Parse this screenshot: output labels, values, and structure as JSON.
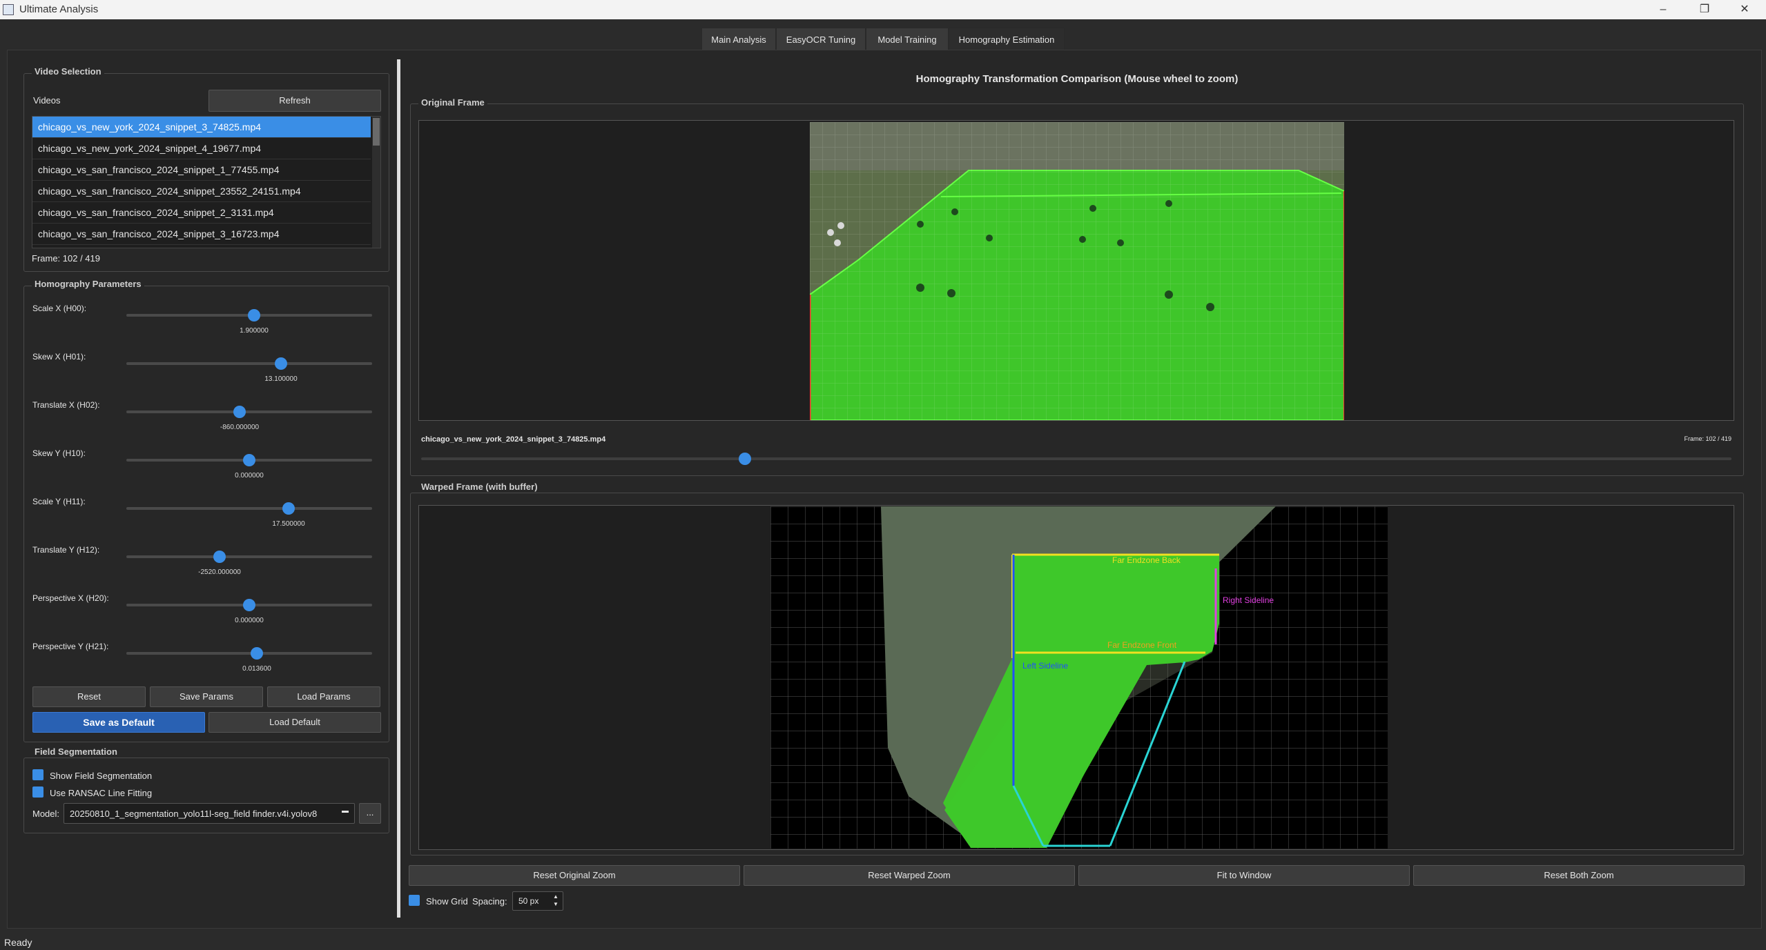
{
  "window": {
    "title": "Ultimate Analysis",
    "min": "–",
    "max": "❐",
    "close": "✕"
  },
  "tabs": [
    "Main Analysis",
    "EasyOCR Tuning",
    "Model Training",
    "Homography Estimation"
  ],
  "video_selection": {
    "title": "Video Selection",
    "videos_label": "Videos",
    "refresh": "Refresh",
    "items": [
      "chicago_vs_new_york_2024_snippet_3_74825.mp4",
      "chicago_vs_new_york_2024_snippet_4_19677.mp4",
      "chicago_vs_san_francisco_2024_snippet_1_77455.mp4",
      "chicago_vs_san_francisco_2024_snippet_23552_24151.mp4",
      "chicago_vs_san_francisco_2024_snippet_2_3131.mp4",
      "chicago_vs_san_francisco_2024_snippet_3_16723.mp4"
    ],
    "frame": "Frame:  102 / 419"
  },
  "homography": {
    "title": "Homography Parameters",
    "params": [
      {
        "label": "Scale X (H00):",
        "value": "1.900000",
        "pos": 0.52
      },
      {
        "label": "Skew X (H01):",
        "value": "13.100000",
        "pos": 0.63
      },
      {
        "label": "Translate X (H02):",
        "value": "-860.000000",
        "pos": 0.46
      },
      {
        "label": "Skew Y (H10):",
        "value": "0.000000",
        "pos": 0.5
      },
      {
        "label": "Scale Y (H11):",
        "value": "17.500000",
        "pos": 0.66
      },
      {
        "label": "Translate Y (H12):",
        "value": "-2520.000000",
        "pos": 0.38
      },
      {
        "label": "Perspective X (H20):",
        "value": "0.000000",
        "pos": 0.5
      },
      {
        "label": "Perspective Y (H21):",
        "value": "0.013600",
        "pos": 0.53
      }
    ],
    "reset": "Reset",
    "save_params": "Save Params",
    "load_params": "Load Params",
    "save_default": "Save as Default",
    "load_default": "Load Default"
  },
  "segmentation": {
    "title": "Field Segmentation",
    "show": "Show Field Segmentation",
    "ransac": "Use RANSAC Line Fitting",
    "model_label": "Model:",
    "model_value": "20250810_1_segmentation_yolo11l-seg_field finder.v4i.yolov8",
    "more": "..."
  },
  "right": {
    "heading": "Homography Transformation Comparison (Mouse wheel to zoom)",
    "original_title": "Original Frame",
    "filename": "chicago_vs_new_york_2024_snippet_3_74825.mp4",
    "frame_small": "Frame: 102 / 419",
    "scrub_pos": 0.247,
    "warped_title": "Warped Frame (with buffer)",
    "overlay": {
      "far_back": "Far Endzone Back",
      "right_side": "Right Sideline",
      "far_front": "Far Endzone Front",
      "left_side": "Left Sideline"
    },
    "reset_original": "Reset Original Zoom",
    "reset_warped": "Reset Warped Zoom",
    "fit": "Fit to Window",
    "reset_both": "Reset Both Zoom",
    "show_grid": "Show Grid",
    "spacing_label": "Spacing:",
    "spacing_value": "50 px"
  },
  "status": "Ready",
  "colors": {
    "accent": "#3a8ee6",
    "field": "#36c61f",
    "warp_edge": "#2ad4d4",
    "yellow": "#f0e020",
    "magenta": "#e040e0",
    "blue_line": "#2050ff"
  }
}
